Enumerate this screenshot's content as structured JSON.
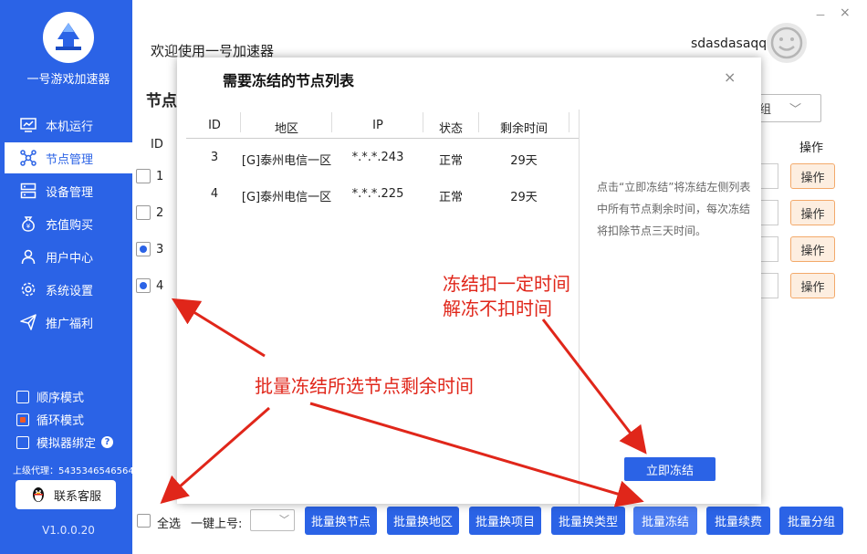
{
  "sidebar": {
    "app_name": "一号游戏加速器",
    "items": [
      {
        "label": "本机运行",
        "icon": "monitor-chart-icon"
      },
      {
        "label": "节点管理",
        "icon": "network-nodes-icon"
      },
      {
        "label": "设备管理",
        "icon": "server-stack-icon"
      },
      {
        "label": "充值购买",
        "icon": "yen-bag-icon"
      },
      {
        "label": "用户中心",
        "icon": "user-icon"
      },
      {
        "label": "系统设置",
        "icon": "gear-icon"
      },
      {
        "label": "推广福利",
        "icon": "send-plane-icon"
      }
    ],
    "modes": [
      {
        "label": "顺序模式",
        "checked": false
      },
      {
        "label": "循环模式",
        "checked": true
      },
      {
        "label": "模拟器绑定",
        "checked": false
      }
    ],
    "proxy": "上级代理：5435346546564",
    "service_button": "联系客服",
    "version": "V1.0.0.20"
  },
  "header": {
    "welcome": "欢迎使用一号加速器",
    "username": "sdasdasaqq",
    "min": "－",
    "close": "×"
  },
  "main": {
    "title": "节点",
    "group_select": "组",
    "col_id": "ID",
    "col_op": "操作",
    "rows": [
      {
        "id": "1",
        "checked": false,
        "op": "操作"
      },
      {
        "id": "2",
        "checked": false,
        "op": "操作"
      },
      {
        "id": "3",
        "checked": true,
        "op": "操作"
      },
      {
        "id": "4",
        "checked": true,
        "op": "操作"
      }
    ]
  },
  "bottom": {
    "select_all": "全选",
    "one_key_label": "一键上号:",
    "buttons": [
      "批量换节点",
      "批量换地区",
      "批量换项目",
      "批量换类型",
      "批量冻结",
      "批量续费",
      "批量分组"
    ]
  },
  "modal": {
    "title": "需要冻结的节点列表",
    "close": "×",
    "headers": [
      "ID",
      "地区",
      "IP",
      "状态",
      "剩余时间"
    ],
    "rows": [
      [
        "3",
        "[G]泰州电信一区",
        "*.*.*.243",
        "正常",
        "29天"
      ],
      [
        "4",
        "[G]泰州电信一区",
        "*.*.*.225",
        "正常",
        "29天"
      ]
    ],
    "hint": "点击“立即冻结”将冻结左侧列表中所有节点剩余时间，每次冻结将扣除节点三天时间。",
    "freeze_button": "立即冻结"
  },
  "annotations": {
    "a1": "冻结扣一定时间",
    "a2": "解冻不扣时间",
    "a3": "批量冻结所选节点剩余时间"
  },
  "colors": {
    "sidebar": "#2b63e6",
    "accent": "#2b63e6",
    "annotation": "#e0261a",
    "op_button": "#fdeee0"
  }
}
